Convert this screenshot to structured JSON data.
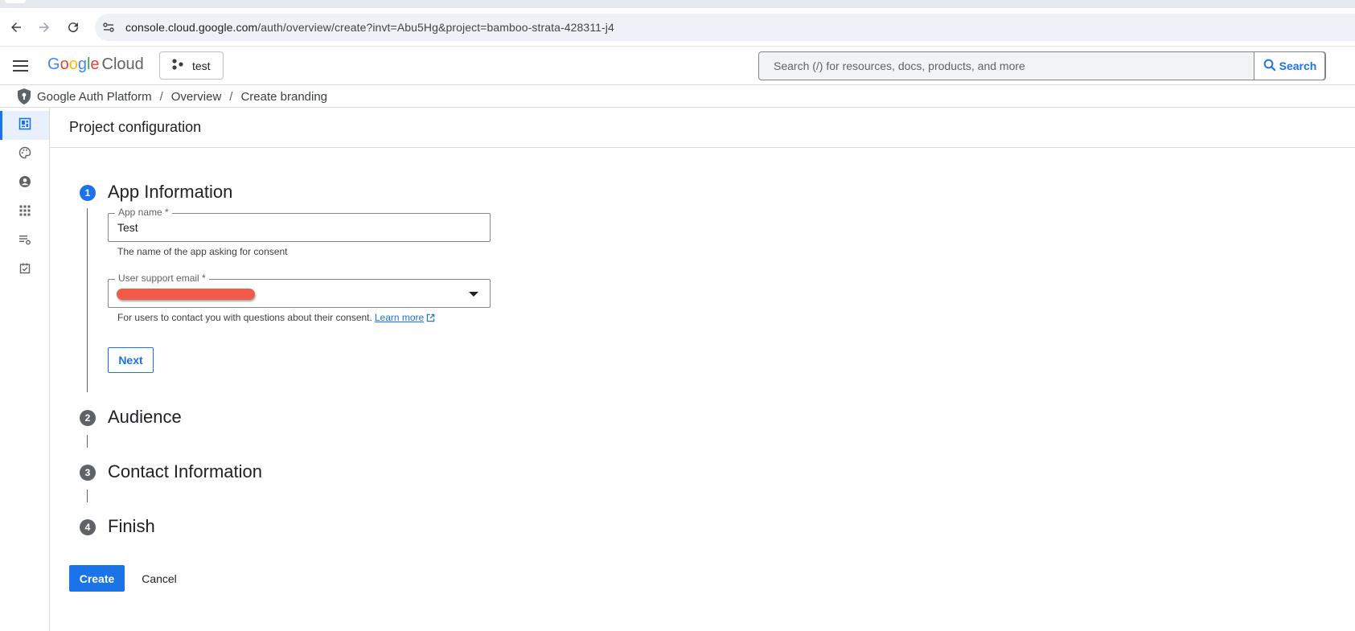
{
  "browser": {
    "url_host": "console.cloud.google.com",
    "url_path": "/auth/overview/create?invt=Abu5Hg&project=bamboo-strata-428311-j4"
  },
  "header": {
    "logo_google": "Google",
    "logo_cloud": "Cloud",
    "project_label": "test",
    "search_placeholder": "Search (/) for resources, docs, products, and more",
    "search_button_label": "Search"
  },
  "breadcrumb": {
    "items": [
      "Google Auth Platform",
      "Overview",
      "Create branding"
    ],
    "separator": "/"
  },
  "rail": {
    "icons": [
      "overview-icon",
      "branding-palette-icon",
      "audience-user-icon",
      "clients-grid-icon",
      "data-access-icon",
      "verification-center-icon"
    ]
  },
  "page": {
    "title": "Project configuration"
  },
  "steps": [
    {
      "number": "1",
      "title": "App Information"
    },
    {
      "number": "2",
      "title": "Audience"
    },
    {
      "number": "3",
      "title": "Contact Information"
    },
    {
      "number": "4",
      "title": "Finish"
    }
  ],
  "form": {
    "app_name_label": "App name *",
    "app_name_value": "Test",
    "app_name_hint": "The name of the app asking for consent",
    "support_email_label": "User support email *",
    "support_email_hint": "For users to contact you with questions about their consent.",
    "learn_more": "Learn more",
    "next_label": "Next"
  },
  "actions": {
    "create_label": "Create",
    "cancel_label": "Cancel"
  },
  "colors": {
    "accent": "#1a73e8",
    "redaction": "#f25a4a"
  }
}
